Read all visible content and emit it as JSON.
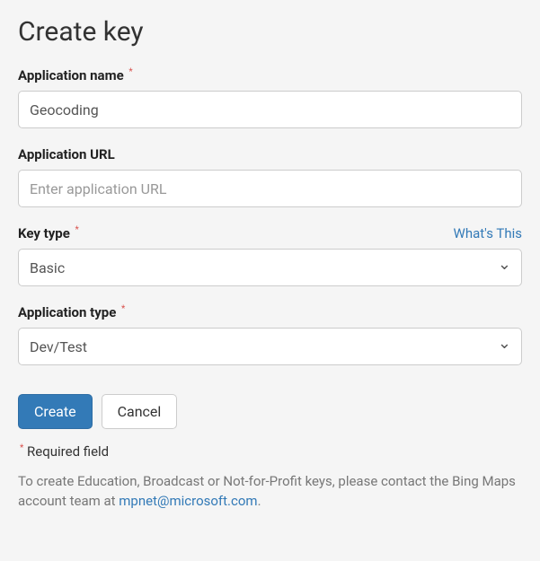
{
  "page": {
    "title": "Create key"
  },
  "form": {
    "app_name": {
      "label": "Application name",
      "required": true,
      "value": "Geocoding"
    },
    "app_url": {
      "label": "Application URL",
      "required": false,
      "placeholder": "Enter application URL",
      "value": ""
    },
    "key_type": {
      "label": "Key type",
      "required": true,
      "help_link": "What's This",
      "selected": "Basic"
    },
    "app_type": {
      "label": "Application type",
      "required": true,
      "selected": "Dev/Test"
    }
  },
  "actions": {
    "create": "Create",
    "cancel": "Cancel"
  },
  "notes": {
    "required": "Required field",
    "info_prefix": "To create Education, Broadcast or Not-for-Profit keys, please contact the Bing Maps account team at ",
    "email": "mpnet@microsoft.com",
    "info_suffix": "."
  }
}
